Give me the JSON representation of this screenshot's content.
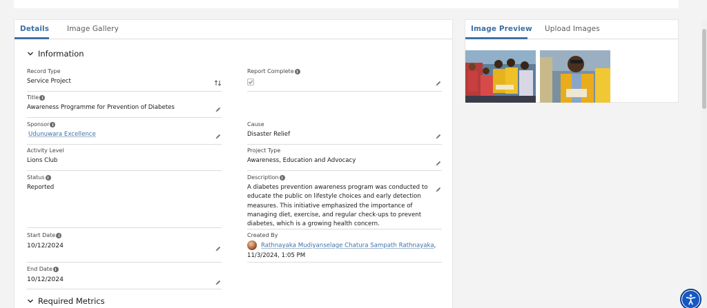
{
  "main_tabs": [
    {
      "label": "Details",
      "active": true
    },
    {
      "label": "Image Gallery",
      "active": false
    }
  ],
  "sections": {
    "information": "Information",
    "required_metrics": "Required Metrics"
  },
  "fields": {
    "record_type": {
      "label": "Record Type",
      "value": "Service Project"
    },
    "report_complete": {
      "label": "Report Complete",
      "checked": true
    },
    "title": {
      "label": "Title",
      "value": "Awareness Programme for Prevention of Diabetes"
    },
    "sponsor": {
      "label": "Sponsor",
      "value": "Udunuwara Excellence"
    },
    "cause": {
      "label": "Cause",
      "value": "Disaster Relief"
    },
    "activity_level": {
      "label": "Activity Level",
      "value": "Lions Club"
    },
    "project_type": {
      "label": "Project Type",
      "value": "Awareness, Education and Advocacy"
    },
    "status": {
      "label": "Status",
      "value": "Reported"
    },
    "description": {
      "label": "Description",
      "lines": [
        "A diabetes prevention awareness program was conducted to",
        "educate the public on lifestyle choices and early detection",
        "measures. This initiative emphasized the importance of",
        "managing diet, exercise, and regular check-ups to prevent",
        "diabetes, which is a growing health concern."
      ]
    },
    "start_date": {
      "label": "Start Date",
      "value": "10/12/2024"
    },
    "created_by": {
      "label": "Created By",
      "user": "Rathnayaka Mudiyanselage Chatura Sampath Rathnayaka",
      "suffix": ",",
      "datetime": "11/3/2024, 1:05 PM"
    },
    "end_date": {
      "label": "End Date",
      "value": "10/12/2024"
    }
  },
  "side_tabs": [
    {
      "label": "Image Preview",
      "active": true
    },
    {
      "label": "Upload Images",
      "active": false
    }
  ],
  "icons": {
    "edit": "pencil-icon",
    "record_type_change": "swap-icon",
    "info": "info-icon",
    "section_toggle": "chevron-down-icon",
    "accessibility": "accessibility-icon"
  },
  "colors": {
    "accent": "#3e6fa6",
    "accessibility_button": "#1458c4"
  }
}
